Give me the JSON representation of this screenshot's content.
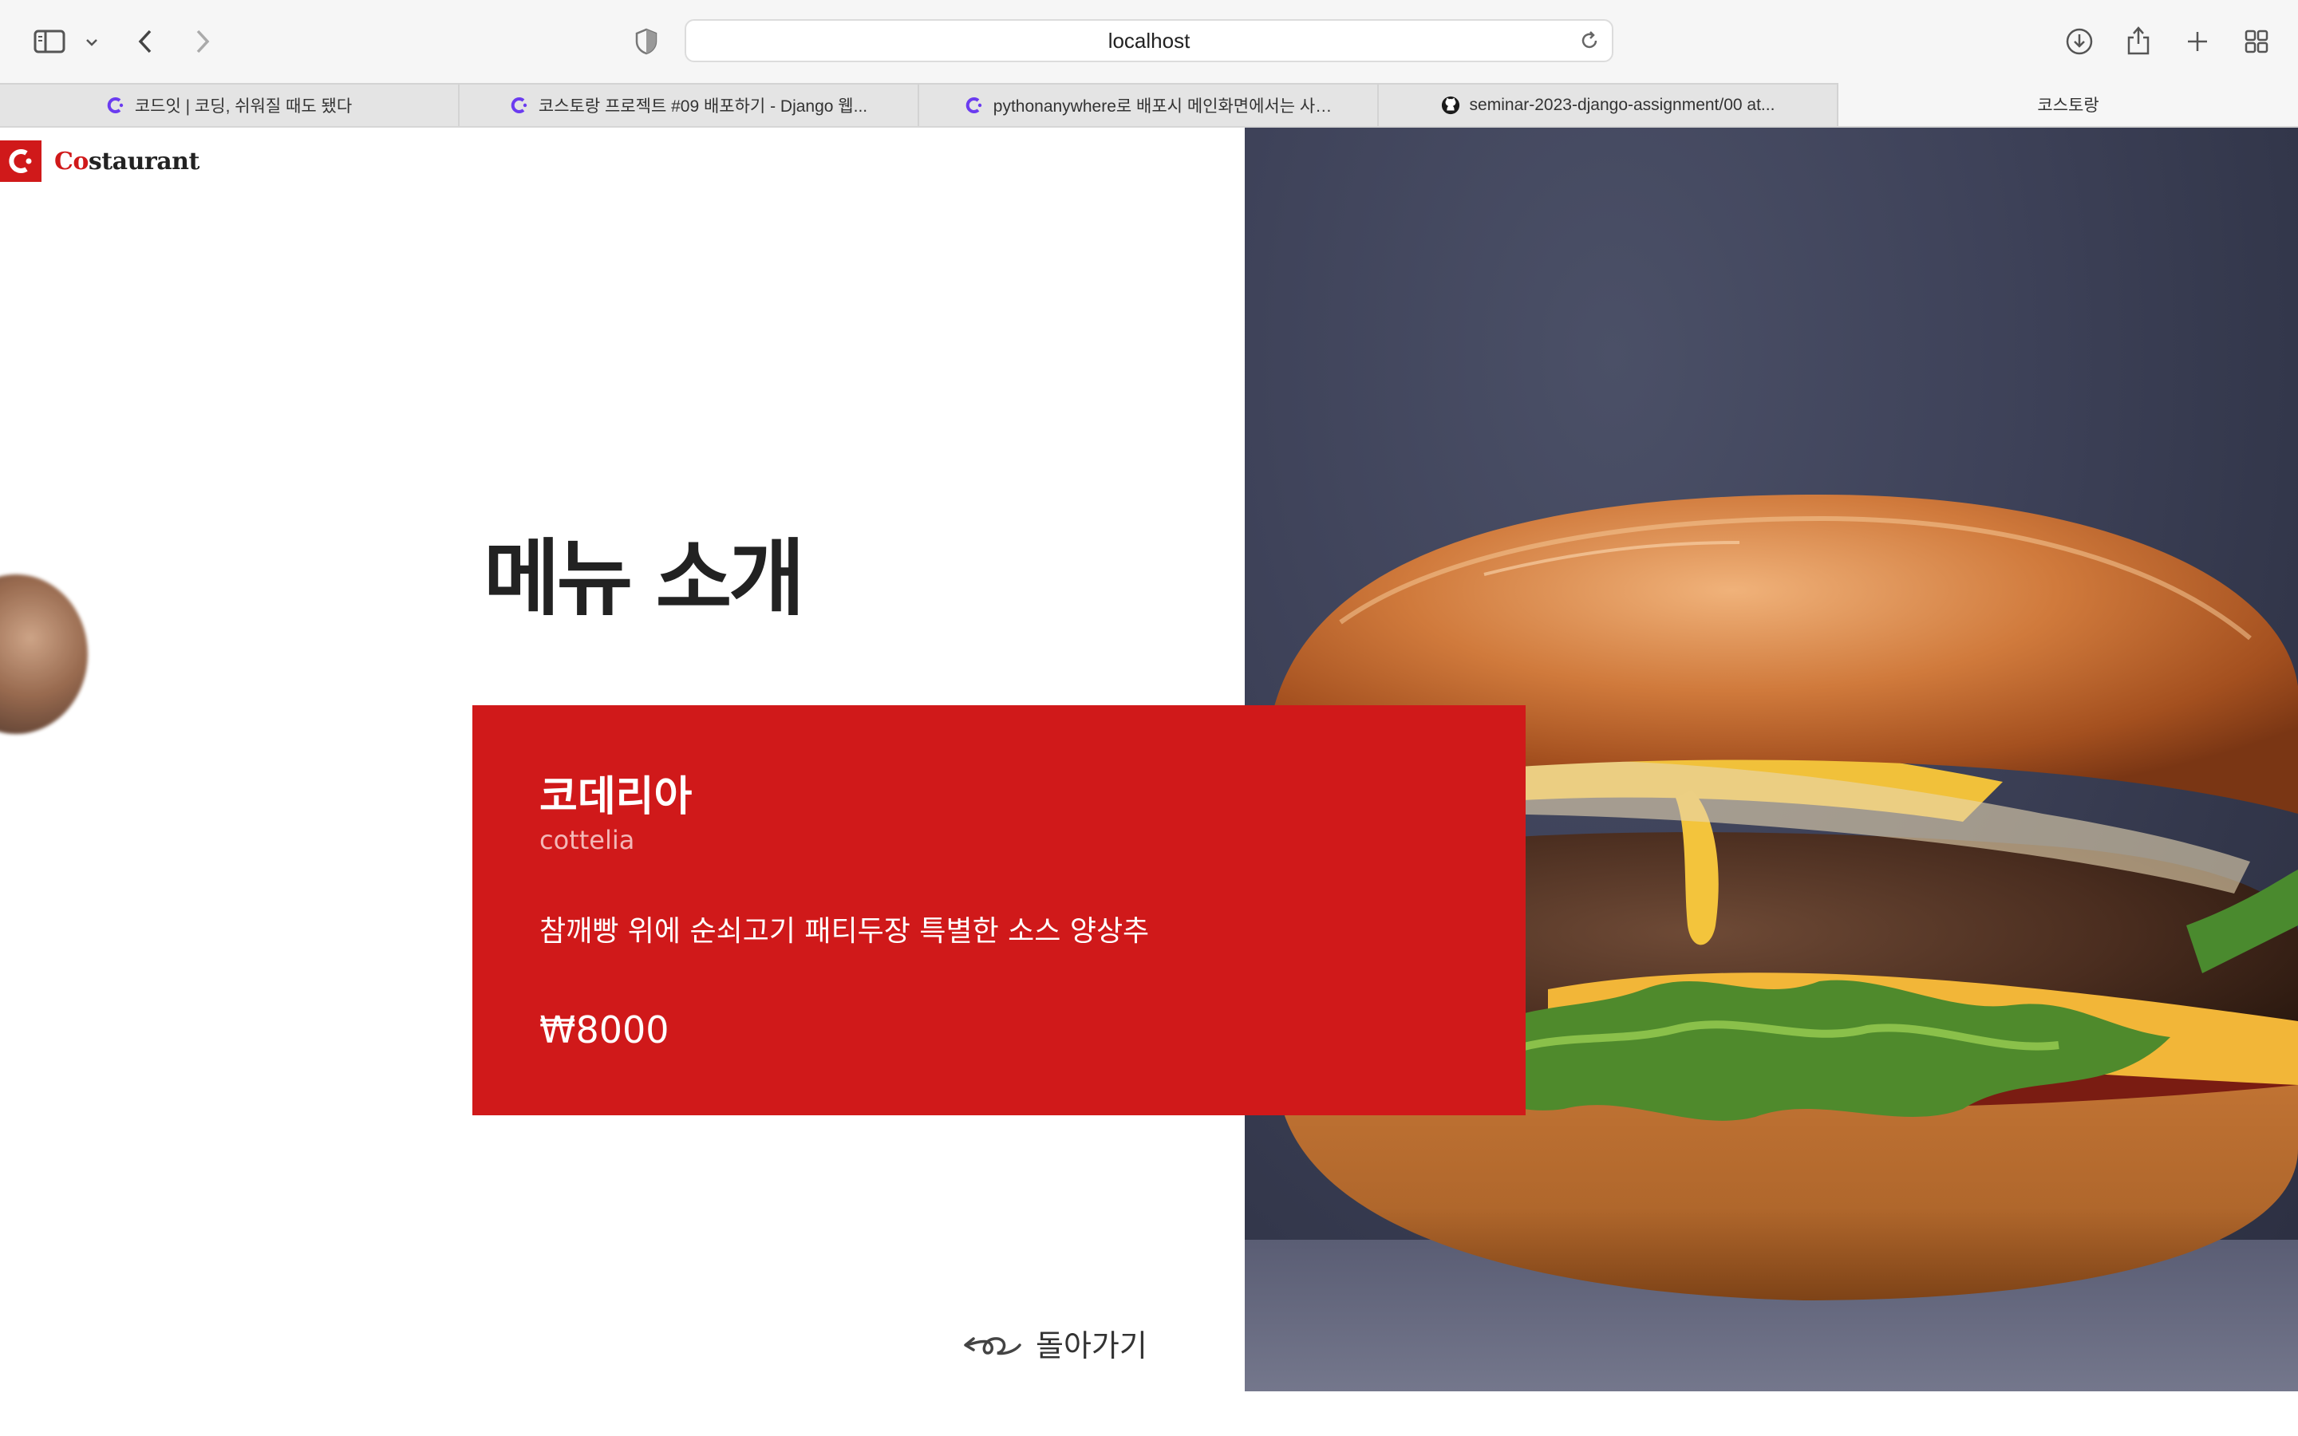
{
  "browser": {
    "url": "localhost",
    "tabs": [
      {
        "title": "코드잇 | 코딩, 쉬워질 때도 됐다",
        "icon": "codeit-icon",
        "active": false
      },
      {
        "title": "코스토랑 프로젝트 #09 배포하기 - Django 웹...",
        "icon": "codeit-icon",
        "active": false
      },
      {
        "title": "pythonanywhere로 배포시 메인화면에서는 사…",
        "icon": "codeit-icon",
        "active": false
      },
      {
        "title": "seminar-2023-django-assignment/00 at...",
        "icon": "github-icon",
        "active": false
      },
      {
        "title": "코스토랑",
        "icon": "",
        "active": true
      }
    ]
  },
  "page": {
    "logo": {
      "initial": "Co",
      "rest": "staurant"
    },
    "section_title": "메뉴 소개",
    "menu": {
      "name": "코데리아",
      "subtitle": "cottelia",
      "description": "참깨빵 위에 순쇠고기 패티두장 특별한 소스 양상추",
      "price": "₩8000"
    },
    "back_label": "돌아가기"
  },
  "colors": {
    "brand": "#d0191a",
    "chrome": "#f6f6f6"
  }
}
